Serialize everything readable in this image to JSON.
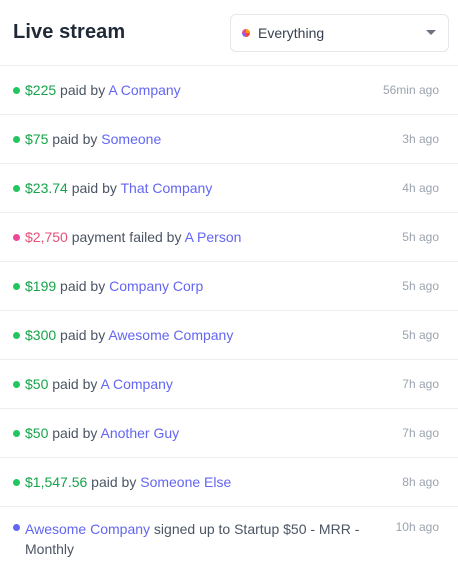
{
  "header": {
    "title": "Live stream",
    "filter": {
      "selected": "Everything",
      "icon": "pie-chart-icon"
    }
  },
  "colors": {
    "paid": "#16a34a",
    "failed": "#e84f7a",
    "link": "#6366f1",
    "signup_dot": "#6366f1"
  },
  "events": [
    {
      "amount": "$225",
      "verb": " paid by ",
      "actor": "A Company",
      "time": "56min ago"
    },
    {
      "amount": "$75",
      "verb": " paid by ",
      "actor": "Someone",
      "time": "3h ago"
    },
    {
      "amount": "$23.74",
      "verb": " paid by ",
      "actor": "That Company",
      "time": "4h ago"
    },
    {
      "amount": "$2,750",
      "verb": " payment failed by ",
      "actor": "A Person",
      "time": "5h ago"
    },
    {
      "amount": "$199",
      "verb": " paid by ",
      "actor": "Company Corp",
      "time": "5h ago"
    },
    {
      "amount": "$300",
      "verb": " paid by ",
      "actor": "Awesome Company",
      "time": "5h ago"
    },
    {
      "amount": "$50",
      "verb": " paid by ",
      "actor": "A Company",
      "time": "7h ago"
    },
    {
      "amount": "$50",
      "verb": " paid by ",
      "actor": "Another Guy",
      "time": "7h ago"
    },
    {
      "amount": "$1,547.56",
      "verb": " paid by ",
      "actor": "Someone Else",
      "time": "8h ago"
    },
    {
      "actor": "Awesome Company",
      "verb": " signed up to ",
      "plan": "Startup $50 - MRR - Monthly",
      "time": "10h ago"
    }
  ]
}
